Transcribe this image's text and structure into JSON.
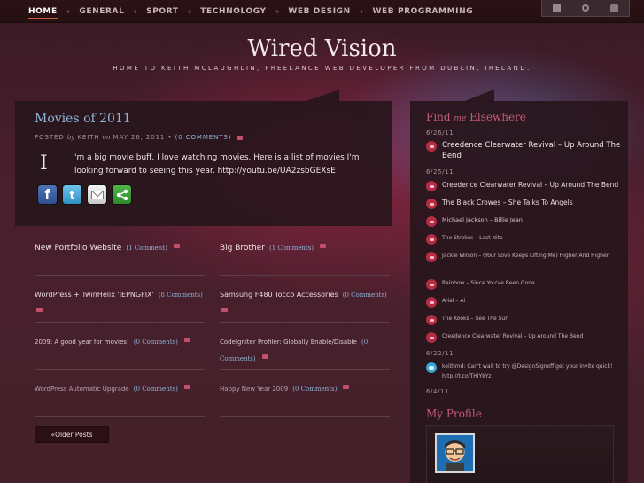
{
  "nav": {
    "items": [
      "Home",
      "General",
      "Sport",
      "Technology",
      "Web Design",
      "Web Programming"
    ],
    "active": "Home"
  },
  "tools": {
    "icons": [
      "page-icon",
      "search-icon",
      "rss-icon"
    ]
  },
  "site": {
    "title": "Wired Vision",
    "tagline": "Home to Keith McLaughlin, freelance web developer from Dublin, Ireland."
  },
  "post": {
    "title": "Movies of 2011",
    "meta_posted": "POSTED",
    "meta_by": "by",
    "meta_author": "KEITH",
    "meta_on": "on",
    "meta_date": "MAY 26, 2011",
    "meta_bullet": "•",
    "meta_comments": "(0 COMMENTS)",
    "dropcap": "I",
    "body": "'m a big movie buff. I love watching movies. Here is a list of movies I'm looking forward to seeing this year. http://youtu.be/UA2zsbGEXsE",
    "share": [
      "facebook-icon",
      "twitter-icon",
      "email-icon",
      "share-icon"
    ],
    "twitter_glyph": "t",
    "facebook_glyph": "f"
  },
  "grid": [
    {
      "title": "New Portfolio Website",
      "comments": "(1 Comment)"
    },
    {
      "title": "Big Brother",
      "comments": "(1 Comments)"
    },
    {
      "title": "WordPress + TwinHelix 'IEPNGFIX'",
      "comments": "(8 Comments)"
    },
    {
      "title": "Samsung F480 Tocco Accessories",
      "comments": "(0 Comments)"
    },
    {
      "title": "2009: A good year for movies!",
      "comments": "(0 Comments)"
    },
    {
      "title": "CodeIgniter Profiler: Globally Enable/Disable",
      "comments": "(0 Comments)"
    },
    {
      "title": "WordPress Automatic Upgrade",
      "comments": "(0 Comments)"
    },
    {
      "title": "Happy New Year 2009",
      "comments": "(0 Comments)"
    }
  ],
  "pagination": {
    "older_label": "«Older Posts"
  },
  "sidebar": {
    "find_heading_pre": "Find",
    "find_heading_me": "me",
    "find_heading_post": "Elsewhere",
    "dates": [
      "6/26/11",
      "6/25/11",
      "6/22/11",
      "6/4/11"
    ],
    "activity": [
      {
        "text": "Creedence Clearwater Revival – Up Around The Bend",
        "icon": "lastfm-icon"
      },
      {
        "text": "Creedence Clearwater Revival – Up Around The Bend",
        "icon": "lastfm-icon"
      },
      {
        "text": "The Black Crowes – She Talks To Angels",
        "icon": "lastfm-icon"
      },
      {
        "text": "Michael Jackson – Billie Jean",
        "icon": "lastfm-icon"
      },
      {
        "text": "The Strokes – Last Nite",
        "icon": "lastfm-icon"
      },
      {
        "text": "Jackie Wilson – (Your Love Keeps Lifting Me) Higher And Higher",
        "icon": "lastfm-icon"
      },
      {
        "text": "Rainbow – Since You've Been Gone",
        "icon": "lastfm-icon"
      },
      {
        "text": "Ariel – Ai",
        "icon": "lastfm-icon"
      },
      {
        "text": "The Kooks – See The Sun",
        "icon": "lastfm-icon"
      },
      {
        "text": "Creedence Clearwater Revival – Up Around The Bend",
        "icon": "lastfm-icon"
      },
      {
        "text": "keithmd: Can't wait to try @DesignSignoff get your invite quick! http://t.co/THIYkYz",
        "icon": "twitter-icon"
      }
    ],
    "profile_heading": "My Profile"
  }
}
